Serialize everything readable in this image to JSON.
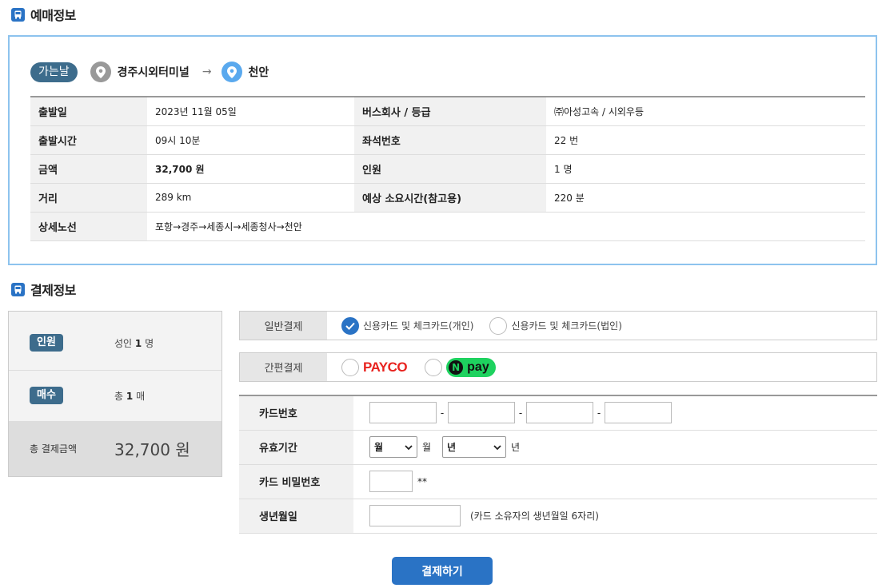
{
  "ticket_section": {
    "title": "예매정보",
    "direction_badge": "가는날",
    "origin": "경주시외터미널",
    "arrow": "→",
    "destination": "천안",
    "rows": [
      {
        "label1": "출발일",
        "value1": "2023년 11월 05일",
        "label2": "버스회사 / 등급",
        "value2": "㈜아성고속 / 시외우등"
      },
      {
        "label1": "출발시간",
        "value1": "09시 10분",
        "label2": "좌석번호",
        "value2": "22 번"
      },
      {
        "label1": "금액",
        "value1": "32,700 원",
        "label2": "인원",
        "value2": "1 명"
      },
      {
        "label1": "거리",
        "value1": "289 km",
        "label2": "예상 소요시간(참고용)",
        "value2": "220 분"
      }
    ],
    "route_label": "상세노선",
    "route_value": "포항→경주→세종시→세종청사→천안"
  },
  "payment_section": {
    "title": "결제정보",
    "summary": {
      "passengers_label": "인원",
      "passengers_prefix": "성인",
      "passengers_count": "1",
      "passengers_unit": "명",
      "tickets_label": "매수",
      "tickets_prefix": "총",
      "tickets_count": "1",
      "tickets_unit": "매",
      "total_label": "총 결제금액",
      "total_value": "32,700 원"
    },
    "general_label": "일반결제",
    "general_options": [
      "신용카드 및 체크카드(개인)",
      "신용카드 및 체크카드(법인)"
    ],
    "general_selected": 0,
    "easy_label": "간편결제",
    "easy_options": [
      "PAYCO",
      "pay"
    ],
    "npay_mark": "N",
    "card_form": {
      "card_number_label": "카드번호",
      "card_sep": "-",
      "expiry_label": "유효기간",
      "month_select": "월",
      "month_unit": "월",
      "year_select": "년",
      "year_unit": "년",
      "pin_label": "카드 비밀번호",
      "pin_suffix": "**",
      "birth_label": "생년월일",
      "birth_note": "(카드 소유자의 생년월일 6자리)"
    },
    "submit_label": "결제하기"
  },
  "colors": {
    "accent": "#2a73c5",
    "badge": "#3d6c8c",
    "npay": "#1ed25f",
    "payco": "#e8231f"
  }
}
